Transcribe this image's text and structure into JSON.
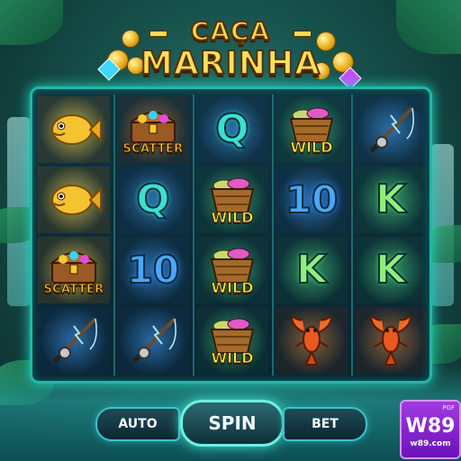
{
  "title": {
    "line1": "CAÇA",
    "line2": "MARINHA"
  },
  "reels": [
    [
      {
        "symbol": "golden-fish",
        "label": ""
      },
      {
        "symbol": "golden-fish",
        "label": ""
      },
      {
        "symbol": "treasure-chest",
        "label": "SCATTER"
      },
      {
        "symbol": "fishing-rod",
        "label": ""
      }
    ],
    [
      {
        "symbol": "treasure-chest",
        "label": "SCATTER"
      },
      {
        "symbol": "letter-q",
        "label": "Q"
      },
      {
        "symbol": "number-10",
        "label": "10"
      },
      {
        "symbol": "fishing-rod",
        "label": ""
      }
    ],
    [
      {
        "symbol": "letter-q",
        "label": "Q"
      },
      {
        "symbol": "fish-basket",
        "label": "WILD"
      },
      {
        "symbol": "fish-basket",
        "label": "WILD"
      },
      {
        "symbol": "fish-basket",
        "label": "WILD"
      }
    ],
    [
      {
        "symbol": "fish-basket",
        "label": "WILD"
      },
      {
        "symbol": "number-10",
        "label": "10"
      },
      {
        "symbol": "letter-k",
        "label": "K"
      },
      {
        "symbol": "lobster",
        "label": ""
      }
    ],
    [
      {
        "symbol": "fishing-rod",
        "label": ""
      },
      {
        "symbol": "letter-k",
        "label": "K"
      },
      {
        "symbol": "letter-k",
        "label": "K"
      },
      {
        "symbol": "lobster",
        "label": ""
      }
    ]
  ],
  "controls": {
    "auto_label": "AUTO",
    "spin_label": "SPIN",
    "bet_label": "BET"
  },
  "brand": {
    "tag": "PGF",
    "name": "W89",
    "url": "w89.com"
  },
  "colors": {
    "frame": "#1fb8a8",
    "title": "#ffd84a",
    "brand": "#8a24d0"
  }
}
